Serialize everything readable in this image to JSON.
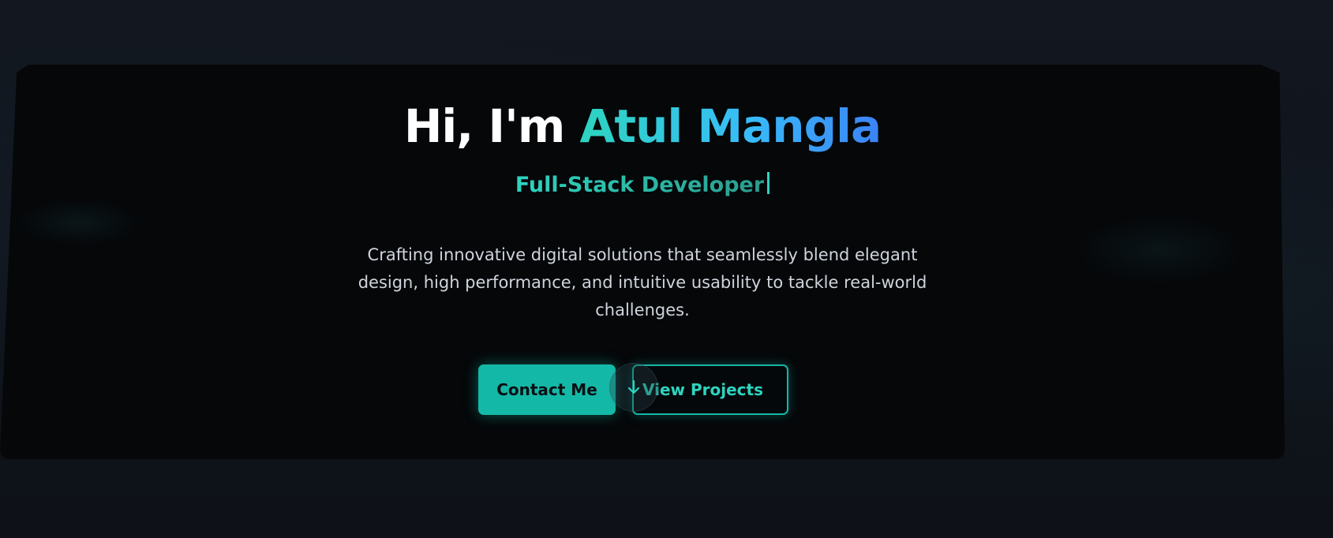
{
  "hero": {
    "greeting": "Hi, I'm ",
    "name": "Atul Mangla",
    "role": "Full-Stack Developer",
    "description": "Crafting innovative digital solutions that seamlessly blend elegant design, high performance, and intuitive usability to tackle real-world challenges."
  },
  "buttons": {
    "contact_label": "Contact Me",
    "projects_label": "View Projects",
    "scroll_icon": "arrow-down-icon"
  },
  "colors": {
    "accent": "#14b8a6",
    "accent_light": "#2dd4bf",
    "gradient_end": "#3b82f6",
    "card_bg": "#050709",
    "page_bg": "#10141b"
  }
}
